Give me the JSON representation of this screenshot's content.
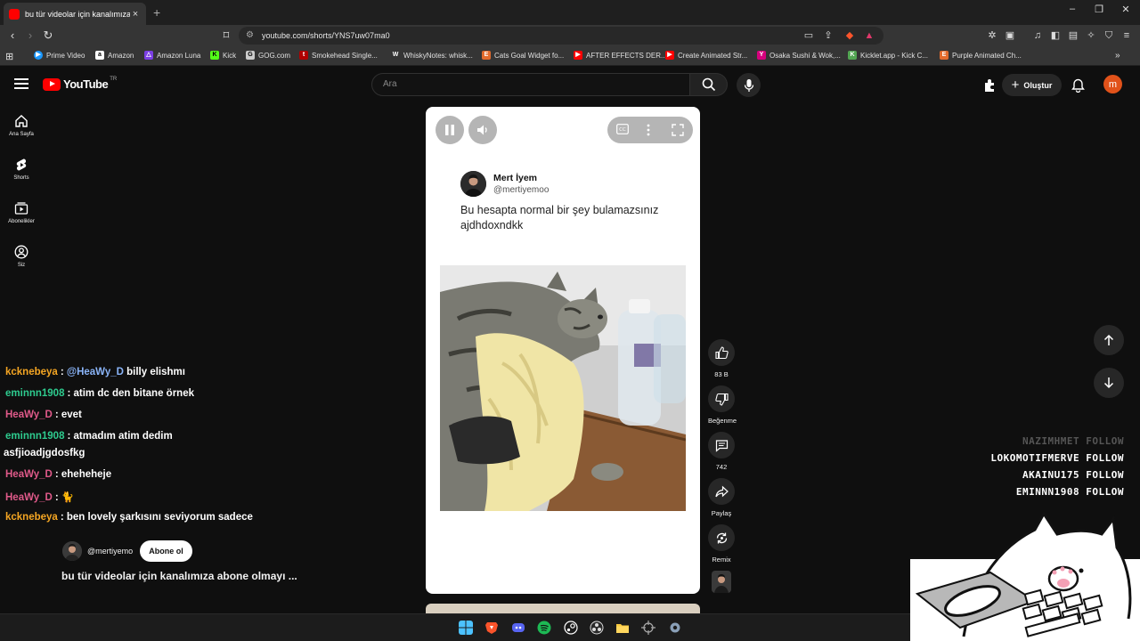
{
  "browser": {
    "tab_title": "bu tür videolar için kanalımıza",
    "tab_close": "×",
    "new_tab": "+",
    "url": "youtube.com/shorts/YNS7uw07ma0",
    "window_minimize": "–",
    "window_restore": "❐",
    "window_close": "✕"
  },
  "bookmarks": [
    {
      "label": "Prime Video",
      "color": "#1a98ff",
      "glyph": "▶"
    },
    {
      "label": "Amazon",
      "color": "#ffffff",
      "glyph": "a"
    },
    {
      "label": "Amazon Luna",
      "color": "#7b3fe4",
      "glyph": "△"
    },
    {
      "label": "Kick",
      "color": "#53fc18",
      "glyph": "K"
    },
    {
      "label": "GOG.com",
      "color": "#cccccc",
      "glyph": "G"
    },
    {
      "label": "Smokehead Single...",
      "color": "#b00000",
      "glyph": "t"
    },
    {
      "label": "WhiskyNotes: whisk...",
      "color": "#333333",
      "glyph": "W"
    },
    {
      "label": "Cats Goal Widget fo...",
      "color": "#e36b2c",
      "glyph": "E"
    },
    {
      "label": "AFTER EFFECTS DER...",
      "color": "#ff0000",
      "glyph": "▶"
    },
    {
      "label": "Create Animated Str...",
      "color": "#ff0000",
      "glyph": "▶"
    },
    {
      "label": "Osaka Sushi & Wok,...",
      "color": "#d6007e",
      "glyph": "Y"
    },
    {
      "label": "Kicklet.app - Kick C...",
      "color": "#53a653",
      "glyph": "K"
    },
    {
      "label": "Purple Animated Ch...",
      "color": "#e36b2c",
      "glyph": "E"
    }
  ],
  "youtube": {
    "logo_text": "YouTube",
    "logo_region": "TR",
    "search_placeholder": "Ara",
    "create_label": "Oluştur",
    "avatar_letter": "m",
    "nav": [
      {
        "label": "Ana Sayfa"
      },
      {
        "label": "Shorts"
      },
      {
        "label": "Abonelikler"
      },
      {
        "label": "Siz"
      }
    ]
  },
  "chat": [
    {
      "user": "kcknebeya",
      "user_color": "#f5a623",
      "message": "@HeaWy_D billy elishmı",
      "mention": "@HeaWy_D",
      "rest": " billy elishmı"
    },
    {
      "user": "eminnn1908",
      "user_color": "#2ecc8f",
      "message": "atim dc den bitane örnek"
    },
    {
      "user": "HeaWy_D",
      "user_color": "#e05a8a",
      "message": "evet"
    },
    {
      "user": "eminnn1908",
      "user_color": "#2ecc8f",
      "message": "atmadım atim dedim"
    },
    {
      "continuation": "asfjioadjgdosfkg"
    },
    {
      "user": "HeaWy_D",
      "user_color": "#e05a8a",
      "message": "eheheheje"
    },
    {
      "user": "HeaWy_D",
      "user_color": "#e05a8a",
      "message": "🐈"
    },
    {
      "user": "kcknebeya",
      "user_color": "#f5a623",
      "message": "ben lovely şarkısını seviyorum sadece"
    }
  ],
  "short": {
    "tweet_name": "Mert İyem",
    "tweet_handle": "@mertiyemoo",
    "tweet_text": "Bu hesapta normal bir şey bulamazsınız ajdhdoxndkk",
    "channel_handle": "@mertiyemo",
    "subscribe_label": "Abone ol",
    "video_title": "bu tür videolar için kanalımıza abone olmayı ..."
  },
  "actions": {
    "like_count": "83 B",
    "dislike_label": "Beğenme",
    "comment_count": "742",
    "share_label": "Paylaş",
    "remix_label": "Remix"
  },
  "follow_overlay": [
    {
      "text": "NAZIMHMET FOLLOW",
      "faded": true
    },
    {
      "text": "LOKOMOTIFMERVE FOLLOW",
      "faded": false
    },
    {
      "text": "AKAINU175 FOLLOW",
      "faded": false
    },
    {
      "text": "EMINNN1908 FOLLOW",
      "faded": false
    }
  ],
  "colors": {
    "yt_red": "#ff0000",
    "bg": "#0f0f0f",
    "mention": "#8ab4f8"
  }
}
